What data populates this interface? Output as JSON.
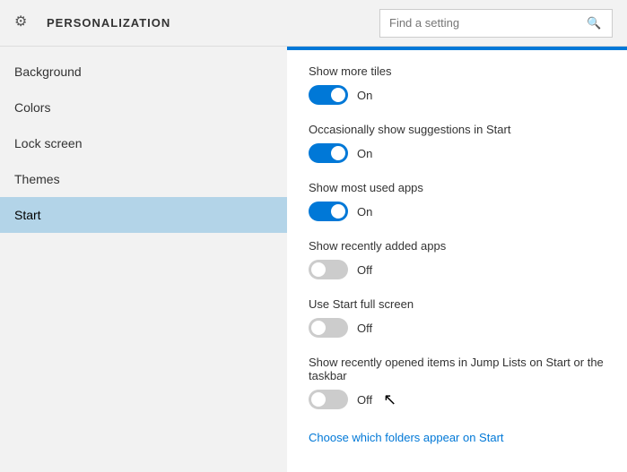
{
  "header": {
    "title": "PERSONALIZATION",
    "search_placeholder": "Find a setting"
  },
  "sidebar": {
    "items": [
      {
        "id": "background",
        "label": "Background"
      },
      {
        "id": "colors",
        "label": "Colors"
      },
      {
        "id": "lock-screen",
        "label": "Lock screen"
      },
      {
        "id": "themes",
        "label": "Themes"
      },
      {
        "id": "start",
        "label": "Start"
      }
    ]
  },
  "content": {
    "settings": [
      {
        "id": "show-more-tiles",
        "label": "Show more tiles",
        "state": "on",
        "status_text": "On"
      },
      {
        "id": "show-suggestions",
        "label": "Occasionally show suggestions in Start",
        "state": "on",
        "status_text": "On"
      },
      {
        "id": "show-most-used",
        "label": "Show most used apps",
        "state": "on",
        "status_text": "On"
      },
      {
        "id": "show-recently-added",
        "label": "Show recently added apps",
        "state": "off",
        "status_text": "Off"
      },
      {
        "id": "use-start-full-screen",
        "label": "Use Start full screen",
        "state": "off",
        "status_text": "Off"
      },
      {
        "id": "show-jump-lists",
        "label": "Show recently opened items in Jump Lists on Start or the taskbar",
        "state": "off",
        "status_text": "Off"
      }
    ],
    "link": {
      "text": "Choose which folders appear on Start",
      "id": "choose-folders-link"
    }
  },
  "icons": {
    "gear": "⚙",
    "search": "🔍"
  }
}
